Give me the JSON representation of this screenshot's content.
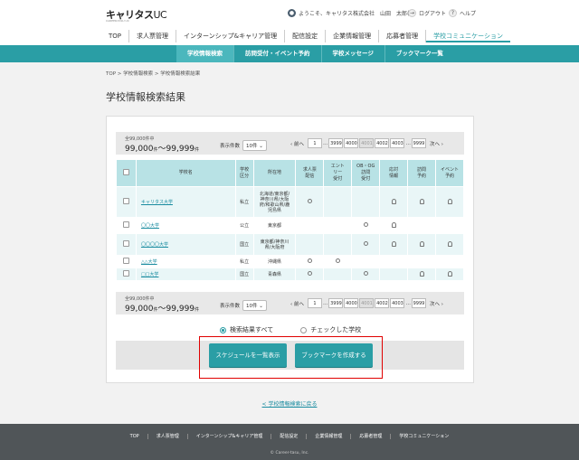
{
  "header": {
    "logo": "キャリタス",
    "logo_uc": "UC",
    "logo_sub": "CAREER-TASU UC",
    "welcome": "ようこそ、キャリタス株式会社　山田　太郎様",
    "logout": "ログアウト",
    "help": "ヘルプ",
    "help_icon": "?"
  },
  "nav": {
    "items": [
      "TOP",
      "求人票管理",
      "インターンシップ&キャリア管理",
      "配信設定",
      "企業情報管理",
      "応募者管理",
      "学校コミュニケーション"
    ]
  },
  "subnav": {
    "items": [
      "学校情報検索",
      "訪問受付・イベント予約",
      "学校メッセージ",
      "ブックマーク一覧"
    ]
  },
  "breadcrumb": "TOP > 学校情報検索 > 学校情報検索結果",
  "page_title": "学校情報検索結果",
  "pager": {
    "total": "全99,000件中",
    "range": "99,000",
    "range_unit": "件",
    "range_sep": "～",
    "range_end": "99,999",
    "per_label": "表示件数",
    "per_value": "10件",
    "prev": "前へ",
    "next": "次へ",
    "pages": [
      "1",
      "…",
      "3999",
      "4000",
      "4001",
      "4002",
      "4003",
      "…",
      "9999"
    ]
  },
  "table": {
    "headers": [
      "学校名",
      "学校\n区分",
      "所在地",
      "求人票\n配信",
      "エント\nリー\n受付",
      "OB・OG\n訪問\n受付",
      "応対\n情報",
      "訪問\n予約",
      "イベント\n予約"
    ],
    "rows": [
      {
        "name": "キャリタス大学",
        "type": "私立",
        "loc": "北海道/東京都/\n神奈川県/大阪\n府/和歌山県/鹿\n児島県",
        "marks": [
          "o",
          "",
          "",
          "b",
          "b",
          "b"
        ]
      },
      {
        "name": "〇〇大学",
        "type": "公立",
        "loc": "東京都",
        "marks": [
          "",
          "",
          "o",
          "b",
          "",
          ""
        ]
      },
      {
        "name": "〇〇〇〇大学",
        "type": "国立",
        "loc": "東京都/神奈川\n県/大阪府",
        "marks": [
          "",
          "",
          "o",
          "b",
          "b",
          "b"
        ]
      },
      {
        "name": "△△大学",
        "type": "私立",
        "loc": "沖縄県",
        "marks": [
          "o",
          "o",
          "",
          "",
          "",
          ""
        ]
      },
      {
        "name": "□□大学",
        "type": "国立",
        "loc": "青森県",
        "marks": [
          "o",
          "",
          "o",
          "",
          "b",
          "b"
        ]
      }
    ]
  },
  "radios": {
    "all": "検索結果すべて",
    "checked": "チェックした学校"
  },
  "buttons": {
    "schedule": "スケジュールを一覧表示",
    "bookmark": "ブックマークを作成する"
  },
  "back_link": "< 学校情報検索に戻る",
  "footer": {
    "links": [
      "TOP",
      "求人票管理",
      "インターンシップ&キャリア管理",
      "配信設定",
      "企業情報管理",
      "応募者管理",
      "学校コミュニケーション"
    ],
    "copyright": "© Career-tasu, Inc."
  }
}
